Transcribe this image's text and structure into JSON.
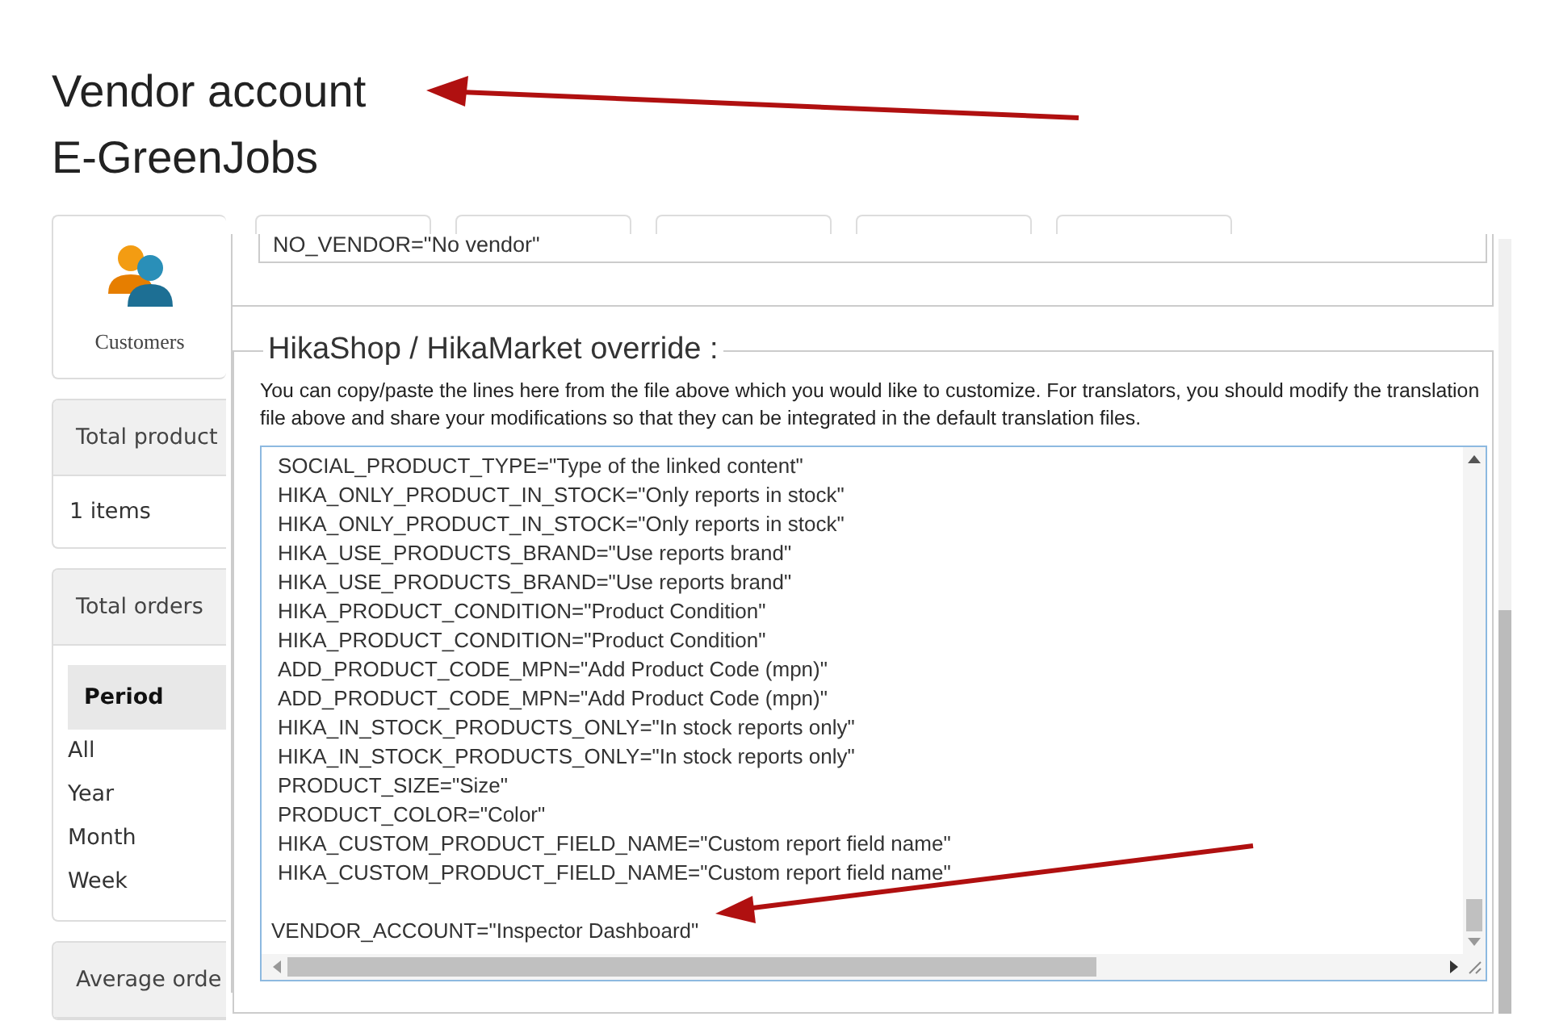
{
  "page": {
    "title": "Vendor account",
    "subtitle": "E-GreenJobs"
  },
  "sidebar": {
    "icon_card": {
      "label": "Customers"
    },
    "cards": [
      {
        "kind": "count",
        "header": "Total product",
        "value": "1 items"
      },
      {
        "kind": "periods",
        "header": "Total orders",
        "column": "Period",
        "rows": [
          "All",
          "Year",
          "Month",
          "Week"
        ]
      },
      {
        "kind": "header",
        "header": "Average orde"
      }
    ]
  },
  "upper_field": {
    "lines": [
      "NO_VENDOR=\"No vendor\""
    ]
  },
  "override": {
    "legend": "HikaShop / HikaMarket override :",
    "description": "You can copy/paste the lines here from the file above which you would like to customize. For translators, you should modify the translation file above and share your modifications so that they can be integrated in the default translation files.",
    "lines": [
      "SOCIAL_PRODUCT_TYPE=\"Type of the linked content\"",
      "HIKA_ONLY_PRODUCT_IN_STOCK=\"Only reports in stock\"",
      "HIKA_ONLY_PRODUCT_IN_STOCK=\"Only reports in stock\"",
      "HIKA_USE_PRODUCTS_BRAND=\"Use reports brand\"",
      "HIKA_USE_PRODUCTS_BRAND=\"Use reports brand\"",
      "HIKA_PRODUCT_CONDITION=\"Product Condition\"",
      "HIKA_PRODUCT_CONDITION=\"Product Condition\"",
      "ADD_PRODUCT_CODE_MPN=\"Add Product Code (mpn)\"",
      "ADD_PRODUCT_CODE_MPN=\"Add Product Code (mpn)\"",
      "HIKA_IN_STOCK_PRODUCTS_ONLY=\"In stock reports only\"",
      "HIKA_IN_STOCK_PRODUCTS_ONLY=\"In stock reports only\"",
      "PRODUCT_SIZE=\"Size\"",
      "PRODUCT_COLOR=\"Color\"",
      "HIKA_CUSTOM_PRODUCT_FIELD_NAME=\"Custom report field name\"",
      "HIKA_CUSTOM_PRODUCT_FIELD_NAME=\"Custom report field name\""
    ],
    "last_line": "VENDOR_ACCOUNT=\"Inspector Dashboard\""
  }
}
